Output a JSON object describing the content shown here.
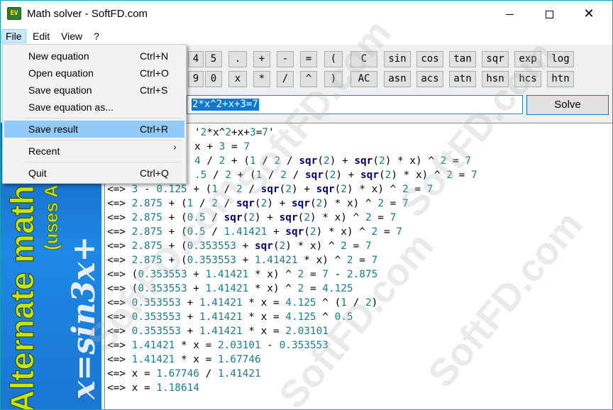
{
  "window": {
    "title": "Math solver - SoftFD.com",
    "icon_text": "EV"
  },
  "menubar": [
    "File",
    "Edit",
    "View",
    "?"
  ],
  "keypad": {
    "row1": [
      "4",
      "5",
      ".",
      "+",
      "-",
      "=",
      "(",
      "C",
      "sin",
      "cos",
      "tan",
      "sqr",
      "exp",
      "log"
    ],
    "row2": [
      "9",
      "0",
      "x",
      "*",
      "/",
      "^",
      ")",
      "AC",
      "asn",
      "acs",
      "atn",
      "hsn",
      "hcs",
      "htn"
    ]
  },
  "equation": {
    "value": "2*x^2+x+3=7",
    "solve_label": "Solve"
  },
  "file_menu": {
    "new": {
      "label": "New equation",
      "shortcut": "Ctrl+N"
    },
    "open": {
      "label": "Open equation",
      "shortcut": "Ctrl+O"
    },
    "save": {
      "label": "Save equation",
      "shortcut": "Ctrl+S"
    },
    "save_as": {
      "label": "Save equation as..."
    },
    "save_result": {
      "label": "Save result",
      "shortcut": "Ctrl+R"
    },
    "recent": {
      "label": "Recent",
      "arrow": "›"
    },
    "quit": {
      "label": "Quit",
      "shortcut": "Ctrl+Q"
    }
  },
  "banner": {
    "line1": "Alternate math",
    "line2": "(uses AEQ",
    "formula": "x=sin3x+"
  },
  "result_lines": [
    "'2*x^2+x+3=7'",
    "x + 3 = 7",
    "4 / 2 + (1 / 2 / sqr(2) + sqr(2) * x) ^ 2 = 7",
    ".5 / 2 + (1 / 2 / sqr(2) + sqr(2) * x) ^ 2 = 7",
    "<=> 3 - 0.125 + (1 / 2 / sqr(2) + sqr(2) * x) ^ 2 = 7",
    "<=> 2.875 + (1 / 2 / sqr(2) + sqr(2) * x) ^ 2 = 7",
    "<=> 2.875 + (0.5 / sqr(2) + sqr(2) * x) ^ 2 = 7",
    "<=> 2.875 + (0.5 / 1.41421 + sqr(2) * x) ^ 2 = 7",
    "<=> 2.875 + (0.353553 + sqr(2) * x) ^ 2 = 7",
    "<=> 2.875 + (0.353553 + 1.41421 * x) ^ 2 = 7",
    "<=> (0.353553 + 1.41421 * x) ^ 2 = 7 - 2.875",
    "<=> (0.353553 + 1.41421 * x) ^ 2 = 4.125",
    "<=> 0.353553 + 1.41421 * x = 4.125 ^ (1 / 2)",
    "<=> 0.353553 + 1.41421 * x = 4.125 ^ 0.5",
    "<=> 0.353553 + 1.41421 * x = 2.03101",
    "<=> 1.41421 * x = 2.03101 - 0.353553",
    "<=> 1.41421 * x = 1.67746",
    "<=> x = 1.67746 / 1.41421",
    "<=> x = 1.18614"
  ],
  "watermark": "SoftFD.com",
  "colors": {
    "title_border": "#1aa0b4",
    "selection": "#0078d7",
    "number": "#1a7c8a",
    "function": "#00006e",
    "banner_text": "#c6e600",
    "menu_highlight": "#91c9f7"
  }
}
